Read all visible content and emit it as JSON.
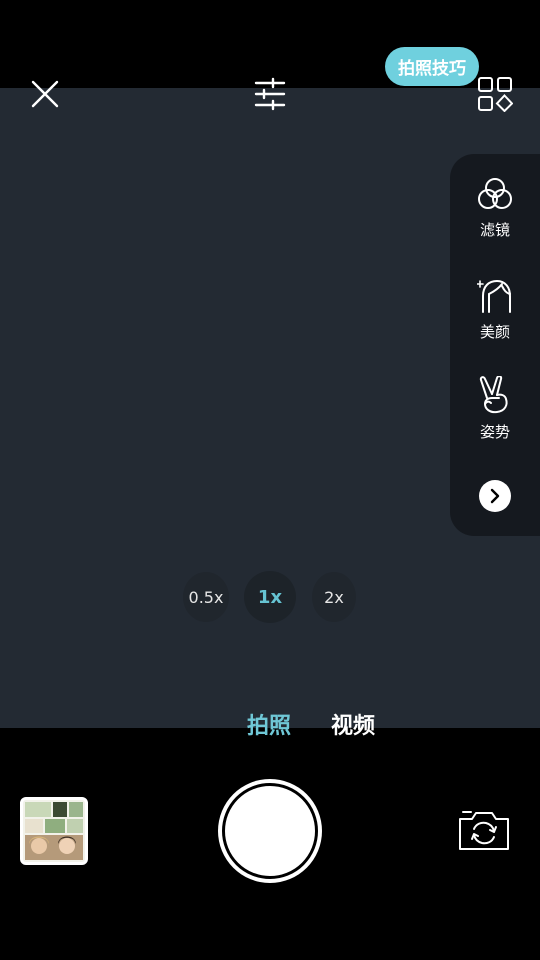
{
  "top_bar": {
    "tip_label": "拍照技巧"
  },
  "side_panel": {
    "items": [
      {
        "label": "滤镜",
        "icon": "filter-icon"
      },
      {
        "label": "美颜",
        "icon": "beauty-face-icon"
      },
      {
        "label": "姿势",
        "icon": "pose-hand-icon"
      }
    ],
    "more_icon": "chevron-right-icon"
  },
  "zoom_levels": [
    {
      "label": "0.5x",
      "active": false
    },
    {
      "label": "1x",
      "active": true
    },
    {
      "label": "2x",
      "active": false
    }
  ],
  "modes": [
    {
      "label": "拍照",
      "active": true
    },
    {
      "label": "视频",
      "active": false
    }
  ],
  "colors": {
    "accent": "#6fc7d6",
    "viewfinder_bg": "#232a33",
    "panel_bg": "#15191f"
  }
}
